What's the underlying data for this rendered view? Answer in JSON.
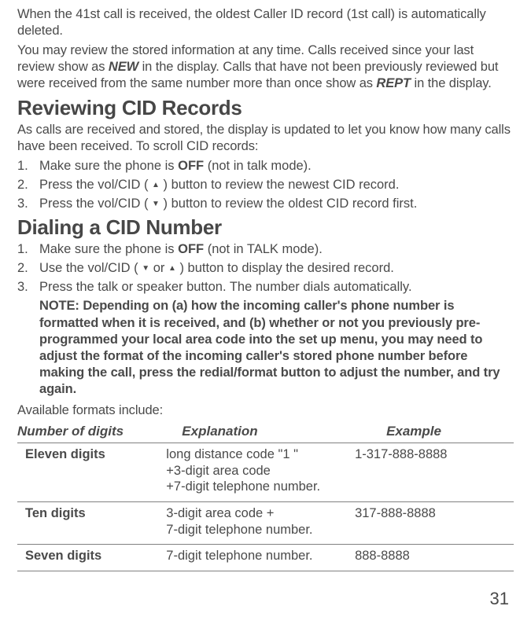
{
  "intro": {
    "p1": "When the 41st call is received, the oldest Caller ID record (1st call) is automatically deleted.",
    "p2a": "You may review the stored information at any time. Calls received since your last review show as ",
    "p2_new": "NEW",
    "p2b": " in the display. Calls that have not been previously reviewed but were received from the same number more than once show as ",
    "p2_rept": "REPT",
    "p2c": " in the display."
  },
  "reviewing": {
    "heading": "Reviewing CID Records",
    "intro": "As calls are received and stored, the display is updated to let you know how many calls have been received. To scroll CID records:",
    "li1a": "Make sure the phone is ",
    "li1_off": "OFF",
    "li1b": " (not in talk mode).",
    "li2": "Press the vol/CID ( ▲ ) button to review the newest CID record.",
    "li3": "Press the vol/CID ( ▼ ) button to review the oldest CID record first."
  },
  "dialing": {
    "heading": "Dialing a CID Number",
    "li1a": "Make sure the phone is ",
    "li1_off": "OFF",
    "li1b": " (not in TALK mode).",
    "li2": "Use the  vol/CID ( ▼ or ▲ )  button to display the desired record.",
    "li3": "Press the talk or speaker button. The number dials automatically.",
    "note": "NOTE: Depending on (a) how the incoming caller's phone number is formatted when it is received, and (b) whether or not you previously pre-programmed your local area code into the set up menu, you may need to adjust the format of the incoming caller's stored phone number before making the call, press the redial/format button to adjust the number, and try again."
  },
  "formats_intro": "Available formats include:",
  "table": {
    "h1": "Number of digits",
    "h2": "Explanation",
    "h3": "Example",
    "rows": [
      {
        "digits": "Eleven digits",
        "expl": "long distance code \"1 \" +3-digit area code +7-digit telephone number.",
        "ex": "1-317-888-8888"
      },
      {
        "digits": "Ten digits",
        "expl": "3-digit area code + 7-digit telephone number.",
        "ex": "317-888-8888"
      },
      {
        "digits": "Seven digits",
        "expl": "7-digit telephone number.",
        "ex": "888-8888"
      }
    ]
  },
  "page_number": "31"
}
